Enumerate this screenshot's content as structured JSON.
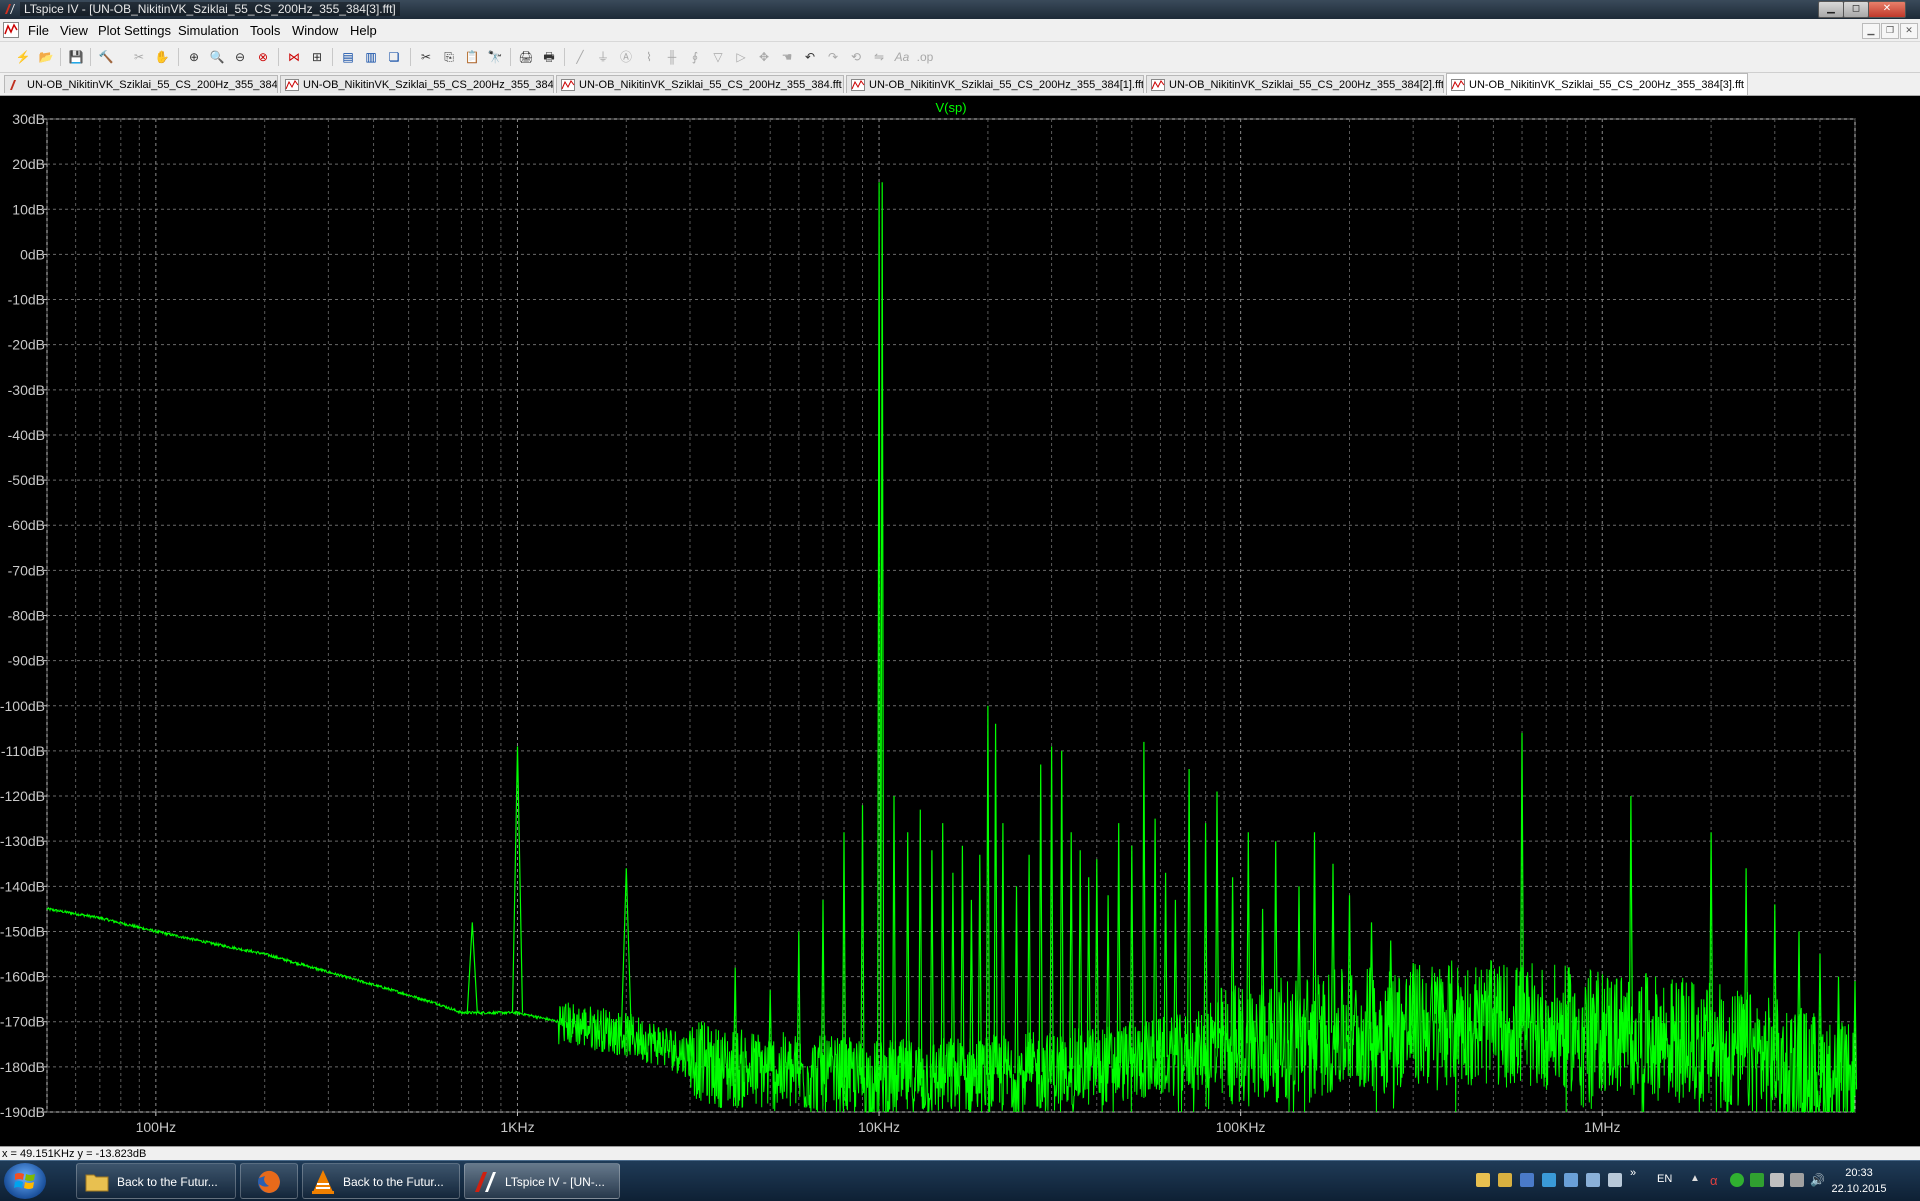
{
  "window": {
    "title": "LTspice IV - [UN-OB_NikitinVK_Sziklai_55_CS_200Hz_355_384[3].fft]",
    "controls": [
      "minimize",
      "maximize",
      "close"
    ]
  },
  "menu": [
    "File",
    "View",
    "Plot Settings",
    "Simulation",
    "Tools",
    "Window",
    "Help"
  ],
  "toolbar_icons": [
    "new-schematic-icon",
    "open-icon",
    "save-icon",
    "control-panel-icon",
    "run-icon",
    "halt-icon",
    "zoom-in-icon",
    "zoom-box-icon",
    "zoom-out-icon",
    "zoom-fit-icon",
    "autorange-icon",
    "select-traces-icon",
    "tile-horizontal-icon",
    "tile-vertical-icon",
    "cascade-icon",
    "cut-icon",
    "copy-icon",
    "paste-icon",
    "find-icon",
    "print-preview-icon",
    "print-icon",
    "wire-icon",
    "ground-icon",
    "label-icon",
    "resistor-icon",
    "capacitor-icon",
    "inductor-icon",
    "diode-icon",
    "component-icon",
    "move-icon",
    "drag-icon",
    "undo-icon",
    "redo-icon",
    "rotate-icon",
    "mirror-icon",
    "text-icon",
    "spice-directive-icon"
  ],
  "tabs": [
    {
      "label": "UN-OB_NikitinVK_Sziklai_55_CS_200Hz_355_384",
      "active": false
    },
    {
      "label": "UN-OB_NikitinVK_Sziklai_55_CS_200Hz_355_384",
      "active": false
    },
    {
      "label": "UN-OB_NikitinVK_Sziklai_55_CS_200Hz_355_384.fft",
      "active": false
    },
    {
      "label": "UN-OB_NikitinVK_Sziklai_55_CS_200Hz_355_384[1].fft",
      "active": false
    },
    {
      "label": "UN-OB_NikitinVK_Sziklai_55_CS_200Hz_355_384[2].fft",
      "active": false
    },
    {
      "label": "UN-OB_NikitinVK_Sziklai_55_CS_200Hz_355_384[3].fft",
      "active": true
    }
  ],
  "chart_data": {
    "type": "line",
    "x_scale": "log",
    "xlim": [
      50,
      5000000
    ],
    "ylim": [
      -190,
      30
    ],
    "grid": true,
    "background": "#000000",
    "trace_color": "#00ff00",
    "series": [
      {
        "name": "V(sp)",
        "baseline": [
          [
            50,
            -145
          ],
          [
            70,
            -147
          ],
          [
            100,
            -150
          ],
          [
            150,
            -153
          ],
          [
            200,
            -155
          ],
          [
            300,
            -159
          ],
          [
            450,
            -163
          ],
          [
            600,
            -166
          ],
          [
            700,
            -168
          ],
          [
            800,
            -168
          ],
          [
            1000,
            -168
          ],
          [
            1300,
            -170
          ],
          [
            1800,
            -172
          ],
          [
            2500,
            -175
          ],
          [
            3500,
            -180
          ],
          [
            5000,
            -181
          ],
          [
            10000,
            -183
          ],
          [
            30000,
            -181
          ],
          [
            60000,
            -178
          ],
          [
            100000,
            -175
          ],
          [
            200000,
            -172
          ],
          [
            400000,
            -170
          ],
          [
            1000000,
            -172
          ],
          [
            2000000,
            -175
          ],
          [
            3500000,
            -180
          ],
          [
            5000000,
            -185
          ]
        ],
        "peaks": [
          {
            "f": 750,
            "db": -148
          },
          {
            "f": 1000,
            "db": -109
          },
          {
            "f": 2000,
            "db": -136
          },
          {
            "f": 3000,
            "db": -172
          },
          {
            "f": 4000,
            "db": -158
          },
          {
            "f": 5000,
            "db": -163
          },
          {
            "f": 6000,
            "db": -150
          },
          {
            "f": 7000,
            "db": -143
          },
          {
            "f": 8000,
            "db": -128
          },
          {
            "f": 9000,
            "db": -122
          },
          {
            "f": 10000,
            "db": 16
          },
          {
            "f": 10200,
            "db": 16
          },
          {
            "f": 11000,
            "db": -120
          },
          {
            "f": 12000,
            "db": -128
          },
          {
            "f": 13000,
            "db": -123
          },
          {
            "f": 14000,
            "db": -132
          },
          {
            "f": 15000,
            "db": -126
          },
          {
            "f": 16000,
            "db": -137
          },
          {
            "f": 17000,
            "db": -131
          },
          {
            "f": 18000,
            "db": -143
          },
          {
            "f": 19000,
            "db": -133
          },
          {
            "f": 20000,
            "db": -100
          },
          {
            "f": 21000,
            "db": -104
          },
          {
            "f": 22000,
            "db": -126
          },
          {
            "f": 24000,
            "db": -140
          },
          {
            "f": 26000,
            "db": -133
          },
          {
            "f": 28000,
            "db": -113
          },
          {
            "f": 30000,
            "db": -109
          },
          {
            "f": 32000,
            "db": -110
          },
          {
            "f": 34000,
            "db": -128
          },
          {
            "f": 36000,
            "db": -132
          },
          {
            "f": 38000,
            "db": -138
          },
          {
            "f": 40000,
            "db": -134
          },
          {
            "f": 43000,
            "db": -142
          },
          {
            "f": 46000,
            "db": -126
          },
          {
            "f": 50000,
            "db": -131
          },
          {
            "f": 54000,
            "db": -108
          },
          {
            "f": 58000,
            "db": -125
          },
          {
            "f": 62000,
            "db": -137
          },
          {
            "f": 66000,
            "db": -143
          },
          {
            "f": 72000,
            "db": -114
          },
          {
            "f": 80000,
            "db": -126
          },
          {
            "f": 86000,
            "db": -119
          },
          {
            "f": 95000,
            "db": -138
          },
          {
            "f": 105000,
            "db": -128
          },
          {
            "f": 115000,
            "db": -145
          },
          {
            "f": 125000,
            "db": -130
          },
          {
            "f": 145000,
            "db": -140
          },
          {
            "f": 160000,
            "db": -128
          },
          {
            "f": 180000,
            "db": -135
          },
          {
            "f": 200000,
            "db": -142
          },
          {
            "f": 230000,
            "db": -148
          },
          {
            "f": 260000,
            "db": -152
          },
          {
            "f": 300000,
            "db": -157
          },
          {
            "f": 350000,
            "db": -160
          },
          {
            "f": 400000,
            "db": -162
          },
          {
            "f": 450000,
            "db": -163
          },
          {
            "f": 600000,
            "db": -106
          },
          {
            "f": 1200000,
            "db": -120
          },
          {
            "f": 2000000,
            "db": -128
          },
          {
            "f": 2500000,
            "db": -136
          },
          {
            "f": 3000000,
            "db": -144
          },
          {
            "f": 3500000,
            "db": -150
          },
          {
            "f": 4000000,
            "db": -155
          },
          {
            "f": 4500000,
            "db": -160
          },
          {
            "f": 5000000,
            "db": -161
          }
        ]
      }
    ],
    "y_ticks": [
      {
        "v": 30,
        "label": "30dB"
      },
      {
        "v": 20,
        "label": "20dB"
      },
      {
        "v": 10,
        "label": "10dB"
      },
      {
        "v": 0,
        "label": "0dB"
      },
      {
        "v": -10,
        "label": "-10dB"
      },
      {
        "v": -20,
        "label": "-20dB"
      },
      {
        "v": -30,
        "label": "-30dB"
      },
      {
        "v": -40,
        "label": "-40dB"
      },
      {
        "v": -50,
        "label": "-50dB"
      },
      {
        "v": -60,
        "label": "-60dB"
      },
      {
        "v": -70,
        "label": "-70dB"
      },
      {
        "v": -80,
        "label": "-80dB"
      },
      {
        "v": -90,
        "label": "-90dB"
      },
      {
        "v": -100,
        "label": "-100dB"
      },
      {
        "v": -110,
        "label": "-110dB"
      },
      {
        "v": -120,
        "label": "-120dB"
      },
      {
        "v": -130,
        "label": "-130dB"
      },
      {
        "v": -140,
        "label": "-140dB"
      },
      {
        "v": -150,
        "label": "-150dB"
      },
      {
        "v": -160,
        "label": "-160dB"
      },
      {
        "v": -170,
        "label": "-170dB"
      },
      {
        "v": -180,
        "label": "-180dB"
      },
      {
        "v": -190,
        "label": "-190dB"
      }
    ],
    "x_ticks": [
      {
        "v": 100,
        "label": "100Hz"
      },
      {
        "v": 1000,
        "label": "1KHz"
      },
      {
        "v": 10000,
        "label": "10KHz"
      },
      {
        "v": 100000,
        "label": "100KHz"
      },
      {
        "v": 1000000,
        "label": "1MHz"
      }
    ]
  },
  "status": {
    "cursor": "x = 49.151KHz   y = -13.823dB"
  },
  "taskbar": {
    "buttons": [
      {
        "label": "Back to the Futur...",
        "icon": "folder-icon",
        "active": false
      },
      {
        "label": "",
        "icon": "firefox-icon",
        "active": false
      },
      {
        "label": "Back to the Futur...",
        "icon": "vlc-icon",
        "active": false
      },
      {
        "label": "LTspice IV - [UN-...",
        "icon": "ltspice-icon",
        "active": true
      }
    ],
    "language": "EN",
    "time": "20:33",
    "date": "22.10.2015"
  }
}
